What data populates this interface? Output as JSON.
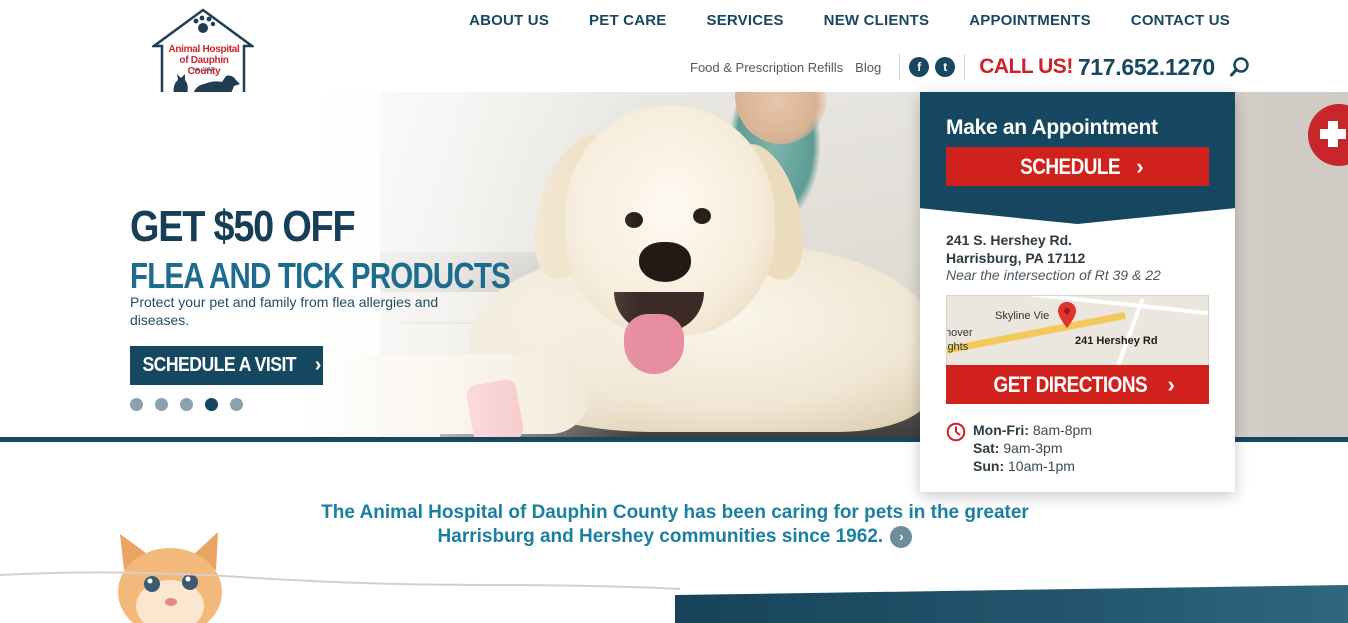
{
  "logo": {
    "name_line1": "Animal Hospital",
    "name_line2": "of Dauphin County",
    "est": "est. 1962"
  },
  "nav": {
    "items": [
      "ABOUT US",
      "PET CARE",
      "SERVICES",
      "NEW CLIENTS",
      "APPOINTMENTS",
      "CONTACT US"
    ]
  },
  "utility": {
    "refills": "Food & Prescription Refills",
    "blog": "Blog",
    "facebook_glyph": "f",
    "twitter_glyph": "t",
    "call_label": "CALL US!",
    "phone": "717.652.1270",
    "icons": [
      "facebook-icon",
      "twitter-icon",
      "search-icon"
    ]
  },
  "hero": {
    "headline": "GET $50 OFF",
    "subheadline": "FLEA AND TICK PRODUCTS",
    "body": "Protect your pet and family from flea allergies and diseases.",
    "cta": "SCHEDULE A VISIT",
    "slide_count": 5,
    "active_slide": 4
  },
  "appointment": {
    "title": "Make an Appointment",
    "schedule_label": "SCHEDULE",
    "address_line1": "241 S. Hershey Rd.",
    "address_line2": "Harrisburg, PA 17112",
    "address_note": "Near the intersection of Rt 39 & 22",
    "map_place": "Skyline Vie",
    "map_frag1": "nover",
    "map_frag2": "ights",
    "map_pin_label": "241 Hershey Rd",
    "directions_label": "GET DIRECTIONS",
    "hours": [
      {
        "day": "Mon-Fri:",
        "time": "8am-8pm"
      },
      {
        "day": "Sat:",
        "time": "9am-3pm"
      },
      {
        "day": "Sun:",
        "time": "10am-1pm"
      }
    ]
  },
  "intro": {
    "line1": "The Animal Hospital of Dauphin County has been caring for pets in the greater",
    "line2": "Harrisburg and Hershey communities since 1962.",
    "arrow": "›"
  },
  "colors": {
    "navy": "#164760",
    "red": "#d0211c",
    "teal_text": "#1a7fa1"
  }
}
